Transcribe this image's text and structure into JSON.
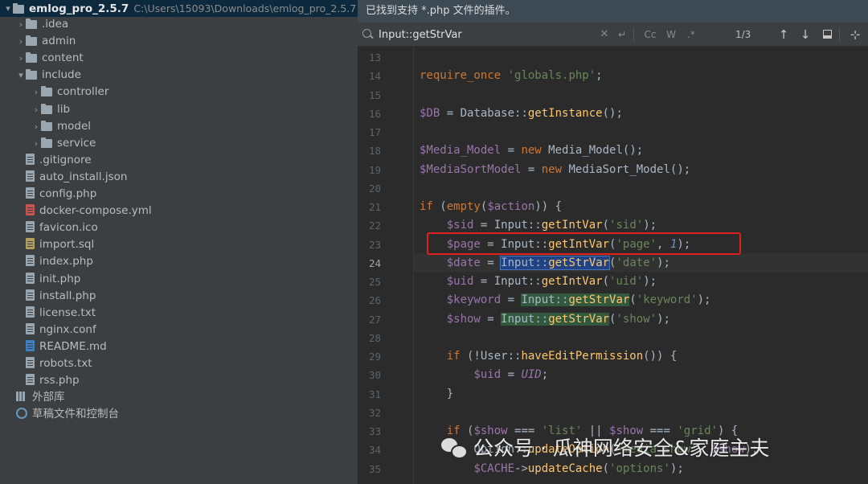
{
  "project": {
    "root_name": "emlog_pro_2.5.7",
    "root_path": "C:\\Users\\15093\\Downloads\\emlog_pro_2.5.7",
    "items": [
      {
        "label": ".idea",
        "kind": "folder",
        "depth": 1,
        "expandable": true
      },
      {
        "label": "admin",
        "kind": "folder",
        "depth": 1,
        "expandable": true
      },
      {
        "label": "content",
        "kind": "folder",
        "depth": 1,
        "expandable": true
      },
      {
        "label": "include",
        "kind": "folder",
        "depth": 1,
        "expandable": true,
        "expanded": true
      },
      {
        "label": "controller",
        "kind": "folder",
        "depth": 2,
        "expandable": true
      },
      {
        "label": "lib",
        "kind": "folder",
        "depth": 2,
        "expandable": true
      },
      {
        "label": "model",
        "kind": "folder",
        "depth": 2,
        "expandable": true
      },
      {
        "label": "service",
        "kind": "folder",
        "depth": 2,
        "expandable": true
      },
      {
        "label": ".gitignore",
        "kind": "file",
        "depth": 1
      },
      {
        "label": "auto_install.json",
        "kind": "file",
        "depth": 1
      },
      {
        "label": "config.php",
        "kind": "file",
        "depth": 1
      },
      {
        "label": "docker-compose.yml",
        "kind": "file-red",
        "depth": 1
      },
      {
        "label": "favicon.ico",
        "kind": "file",
        "depth": 1
      },
      {
        "label": "import.sql",
        "kind": "file-sql",
        "depth": 1
      },
      {
        "label": "index.php",
        "kind": "file",
        "depth": 1
      },
      {
        "label": "init.php",
        "kind": "file",
        "depth": 1
      },
      {
        "label": "install.php",
        "kind": "file",
        "depth": 1
      },
      {
        "label": "license.txt",
        "kind": "file",
        "depth": 1
      },
      {
        "label": "nginx.conf",
        "kind": "file",
        "depth": 1
      },
      {
        "label": "README.md",
        "kind": "file-md",
        "depth": 1
      },
      {
        "label": "robots.txt",
        "kind": "file",
        "depth": 1
      },
      {
        "label": "rss.php",
        "kind": "file",
        "depth": 1
      }
    ],
    "external_libraries": "外部库",
    "scratches": "草稿文件和控制台"
  },
  "editor": {
    "notice": "已找到支持 *.php 文件的插件。",
    "search": {
      "value": "Input::getStrVar",
      "match_count": "1/3",
      "match_case": "Cc",
      "words": "W",
      "regex": ".*"
    },
    "current_line": "24",
    "lines": [
      {
        "n": "13",
        "html": ""
      },
      {
        "n": "14",
        "html": "<span class='kw'>require_once</span> <span class='str'>'globals.php'</span>;"
      },
      {
        "n": "15",
        "html": ""
      },
      {
        "n": "16",
        "html": "<span class='var'>$DB</span> = Database::<span class='fn'>getInstance</span>();"
      },
      {
        "n": "17",
        "html": ""
      },
      {
        "n": "18",
        "html": "<span class='var'>$Media_Model</span> = <span class='kw'>new</span> Media_Model();"
      },
      {
        "n": "19",
        "html": "<span class='var'>$MediaSortModel</span> = <span class='kw'>new</span> MediaSort_Model();"
      },
      {
        "n": "20",
        "html": ""
      },
      {
        "n": "21",
        "html": "<span class='kw'>if</span> (<span class='kw'>empty</span>(<span class='var'>$action</span>)) {"
      },
      {
        "n": "22",
        "html": "    <span class='var'>$sid</span> = Input::<span class='fn'>getIntVar</span>(<span class='str'>'sid'</span>);"
      },
      {
        "n": "23",
        "html": "    <span class='var'>$page</span> = Input::<span class='fn'>getIntVar</span>(<span class='str'>'page'</span>, <span class='num'>1</span>);"
      },
      {
        "n": "24",
        "html": "    <span class='var'>$date</span> = <span class='hl'>Input::<span class='fn'>getStrVar</span></span>(<span class='str'>'date'</span>);"
      },
      {
        "n": "25",
        "html": "    <span class='var'>$uid</span> = Input::<span class='fn'>getIntVar</span>(<span class='str'>'uid'</span>);"
      },
      {
        "n": "26",
        "html": "    <span class='var'>$keyword</span> = <span class='hlg'>Input::<span class='fn'>getStrVar</span></span>(<span class='str'>'keyword'</span>);"
      },
      {
        "n": "27",
        "html": "    <span class='var'>$show</span> = <span class='hlg'>Input::<span class='fn'>getStrVar</span></span>(<span class='str'>'show'</span>);"
      },
      {
        "n": "28",
        "html": ""
      },
      {
        "n": "29",
        "html": "    <span class='kw'>if</span> (!User::<span class='fn'>haveEditPermission</span>()) {"
      },
      {
        "n": "30",
        "html": "        <span class='var'>$uid</span> = <span class='const'>UID</span>;"
      },
      {
        "n": "31",
        "html": "    }"
      },
      {
        "n": "32",
        "html": ""
      },
      {
        "n": "33",
        "html": "    <span class='kw'>if</span> (<span class='var'>$show</span> === <span class='str'>'list'</span> || <span class='var'>$show</span> === <span class='str'>'grid'</span>) {"
      },
      {
        "n": "34",
        "html": "        Option::<span class='fn'>updateOption</span>(<span class='str'>'media_show'</span>, <span class='var'>$show</span>);"
      },
      {
        "n": "35",
        "html": "        <span class='var'>$CACHE</span>-&gt;<span class='fn'>updateCache</span>(<span class='str'>'options'</span>);"
      }
    ]
  },
  "watermark": {
    "text": "公众号 · 瓜神网络安全&家庭主夫"
  },
  "colors": {
    "highlight_box": "#e0201c",
    "keyword": "#cc7832",
    "string": "#6a8759",
    "variable": "#9876aa",
    "function": "#ffc66d"
  }
}
